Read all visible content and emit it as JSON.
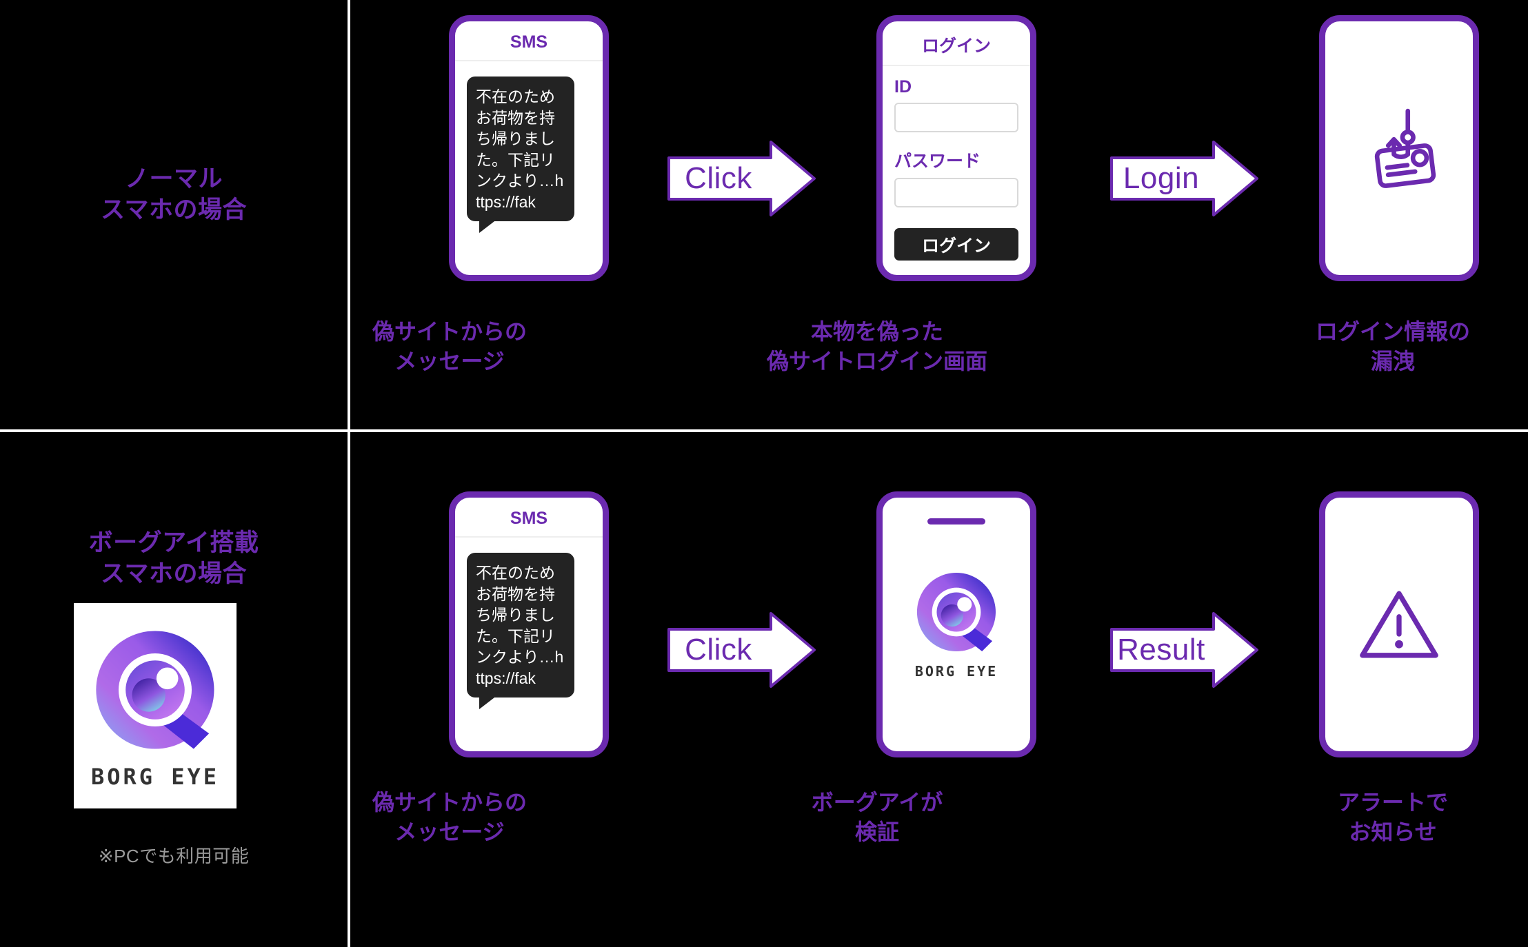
{
  "theme": {
    "background": "#000000",
    "accent_purple": "#6B2AAF",
    "divider": "#ffffff",
    "bubble_dark": "#232323",
    "note_gray": "#9a9a9a"
  },
  "rows": [
    {
      "label": "ノーマル\nスマホの場合",
      "label_line1": "ノーマル",
      "label_line2": "スマホの場合",
      "steps": [
        {
          "phone_type": "sms",
          "title": "SMS",
          "message": "不在のためお荷物を持ち帰りました。下記リンクより…https://fak",
          "caption_line1": "偽サイトからの",
          "caption_line2": "メッセージ"
        },
        {
          "phone_type": "login-form",
          "title": "ログイン",
          "id_label": "ID",
          "id_value": "",
          "password_label": "パスワード",
          "password_value": "",
          "submit_label": "ログイン",
          "caption_line1": "本物を偽った",
          "caption_line2": "偽サイトログイン画面"
        },
        {
          "phone_type": "icon",
          "icon": "phishing-hook-card-icon",
          "caption_line1": "ログイン情報の",
          "caption_line2": "漏洩"
        }
      ],
      "arrows": [
        {
          "label": "Click"
        },
        {
          "label": "Login"
        }
      ]
    },
    {
      "label": "ボーグアイ搭載\nスマホの場合",
      "label_line1": "ボーグアイ搭載",
      "label_line2": "スマホの場合",
      "logo_card": {
        "wordmark": "BORG EYE",
        "icon": "borg-eye-logo-icon"
      },
      "note": "※PCでも利用可能",
      "steps": [
        {
          "phone_type": "sms",
          "title": "SMS",
          "message": "不在のためお荷物を持ち帰りました。下記リンクより…https://fak",
          "caption_line1": "偽サイトからの",
          "caption_line2": "メッセージ"
        },
        {
          "phone_type": "app",
          "app_name": "BORG EYE",
          "icon": "borg-eye-logo-icon",
          "caption_line1": "ボーグアイが",
          "caption_line2": "検証"
        },
        {
          "phone_type": "icon",
          "icon": "warning-triangle-icon",
          "caption_line1": "アラートで",
          "caption_line2": "お知らせ"
        }
      ],
      "arrows": [
        {
          "label": "Click"
        },
        {
          "label": "Result"
        }
      ]
    }
  ]
}
